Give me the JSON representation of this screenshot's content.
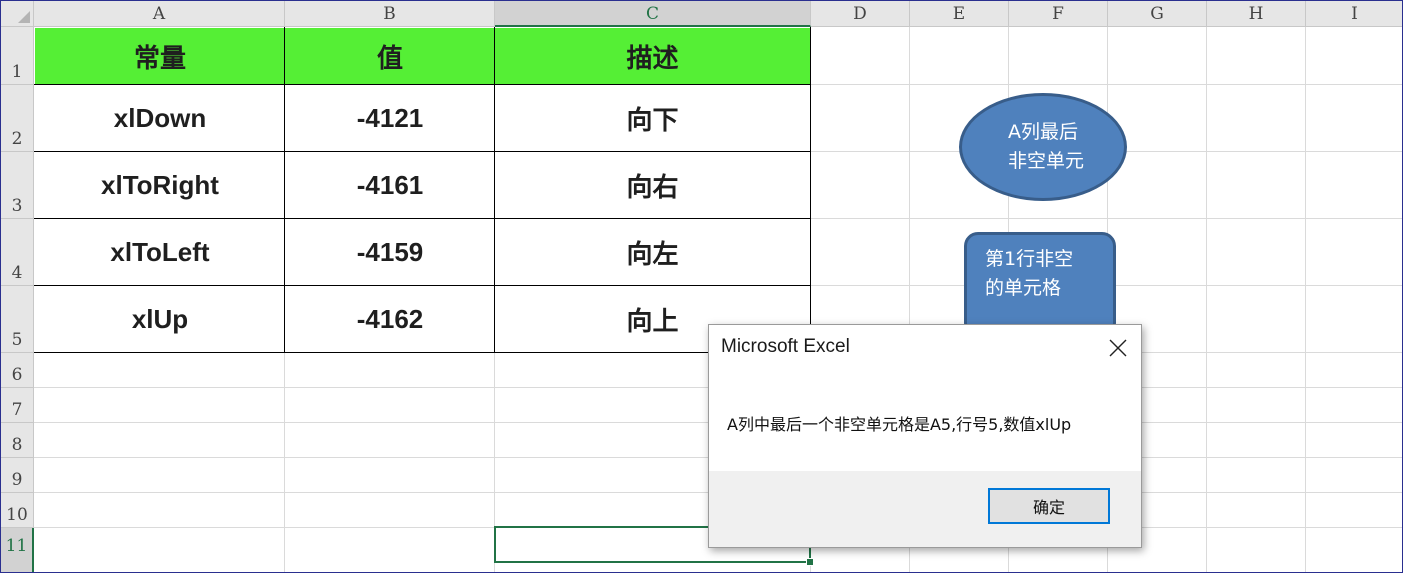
{
  "sheet": {
    "columns": [
      "A",
      "B",
      "C",
      "D",
      "E",
      "F",
      "G",
      "H",
      "I"
    ],
    "selected_column": "C",
    "rows": [
      "1",
      "2",
      "3",
      "4",
      "5",
      "6",
      "7",
      "8",
      "9",
      "10",
      "11"
    ],
    "selected_row": "11",
    "selected_cell": "C11",
    "gridline_color": "#dadada",
    "header_fill_color": "#55ef35"
  },
  "table": {
    "headers": [
      "常量",
      "值",
      "描述"
    ],
    "rows": [
      [
        "xlDown",
        "-4121",
        "向下"
      ],
      [
        "xlToRight",
        "-4161",
        "向右"
      ],
      [
        "xlToLeft",
        "-4159",
        "向左"
      ],
      [
        "xlUp",
        "-4162",
        "向上"
      ]
    ]
  },
  "shapes": {
    "ellipse_text": "A列最后\n 非空单元",
    "rounded_rect_text": "第1行非空\n的单元格",
    "fill_color": "#4f81bd"
  },
  "dialog": {
    "title": "Microsoft Excel",
    "message": "A列中最后一个非空单元格是A5,行号5,数值xlUp",
    "ok_label": "确定",
    "close_icon": "close-icon"
  }
}
